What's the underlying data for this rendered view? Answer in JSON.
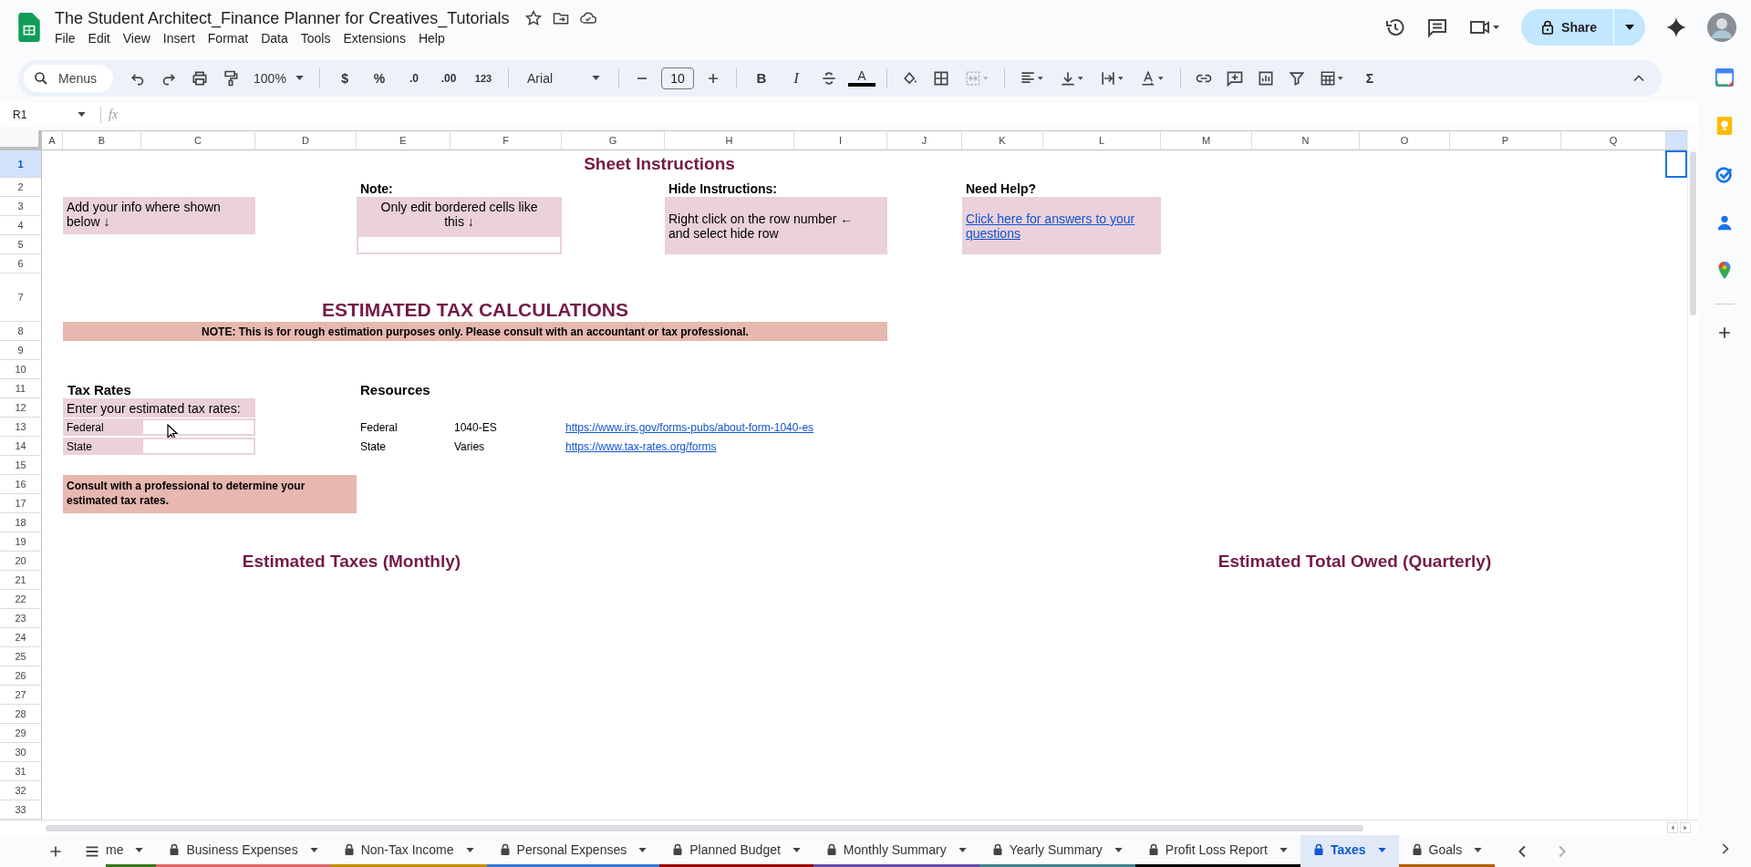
{
  "document": {
    "title": "The Student Architect_Finance Planner for Creatives_Tutorials"
  },
  "menu": [
    "File",
    "Edit",
    "View",
    "Insert",
    "Format",
    "Data",
    "Tools",
    "Extensions",
    "Help"
  ],
  "share": {
    "label": "Share"
  },
  "toolbar": {
    "search_label": "Menus",
    "zoom": "100%",
    "currency": "$",
    "percent": "%",
    "decrease_decimals": ".0",
    "increase_decimals": ".00",
    "more_formats": "123",
    "font": "Arial",
    "font_size": "10",
    "bold": "B",
    "italic": "I",
    "text_color": "A",
    "sum": "Σ",
    "merge_disabled": true
  },
  "name_box": "R1",
  "formula_label": "fx",
  "columns": [
    {
      "label": "A",
      "selected": false
    },
    {
      "label": "B",
      "selected": false
    },
    {
      "label": "C",
      "selected": false
    },
    {
      "label": "D",
      "selected": false
    },
    {
      "label": "E",
      "selected": false
    },
    {
      "label": "F",
      "selected": false
    },
    {
      "label": "G",
      "selected": false
    },
    {
      "label": "H",
      "selected": false
    },
    {
      "label": "I",
      "selected": false
    },
    {
      "label": "J",
      "selected": false
    },
    {
      "label": "K",
      "selected": false
    },
    {
      "label": "L",
      "selected": false
    },
    {
      "label": "M",
      "selected": false
    },
    {
      "label": "N",
      "selected": false
    },
    {
      "label": "O",
      "selected": false
    },
    {
      "label": "P",
      "selected": false
    },
    {
      "label": "Q",
      "selected": false
    },
    {
      "selected": true
    }
  ],
  "rows": [
    {
      "label": "1",
      "selected": true
    },
    {
      "label": "2",
      "selected": false
    },
    {
      "label": "3",
      "selected": false
    },
    {
      "label": "4",
      "selected": false
    },
    {
      "label": "5",
      "selected": false
    },
    {
      "label": "6",
      "selected": false
    },
    {
      "label": "7",
      "selected": false
    },
    {
      "label": "8",
      "selected": false
    },
    {
      "label": "9",
      "selected": false
    },
    {
      "label": "10",
      "selected": false
    },
    {
      "label": "11",
      "selected": false
    },
    {
      "label": "12",
      "selected": false
    },
    {
      "label": "13",
      "selected": false
    },
    {
      "label": "14",
      "selected": false
    },
    {
      "label": "15",
      "selected": false
    },
    {
      "label": "16",
      "selected": false
    },
    {
      "label": "17",
      "selected": false
    },
    {
      "label": "18",
      "selected": false
    },
    {
      "label": "19",
      "selected": false
    },
    {
      "label": "20",
      "selected": false
    },
    {
      "label": "21",
      "selected": false
    },
    {
      "label": "22",
      "selected": false
    },
    {
      "label": "23",
      "selected": false
    },
    {
      "label": "24",
      "selected": false
    },
    {
      "label": "25",
      "selected": false
    },
    {
      "label": "26",
      "selected": false
    },
    {
      "label": "27",
      "selected": false
    },
    {
      "label": "28",
      "selected": false
    },
    {
      "label": "29",
      "selected": false
    },
    {
      "label": "30",
      "selected": false
    },
    {
      "label": "31",
      "selected": false
    },
    {
      "label": "32",
      "selected": false
    },
    {
      "label": "33",
      "selected": false
    }
  ],
  "instructions": {
    "title": "Sheet Instructions",
    "info": "Add your info where shown below ↓",
    "note_heading": "Note:",
    "note": "Only edit bordered cells like this ↓",
    "hide_heading": "Hide Instructions:",
    "hide": "Right click on the row number ←  and select hide row",
    "help_heading": "Need Help?",
    "help_link": "Click here for answers to your questions"
  },
  "tax_calc": {
    "title": "ESTIMATED TAX CALCULATIONS",
    "note": "NOTE: This is for rough estimation purposes only. Please consult with an accountant or tax professional."
  },
  "tax_rates": {
    "heading": "Tax Rates",
    "prompt": "Enter your estimated tax rates:",
    "rows": [
      {
        "label": "Federal"
      },
      {
        "label": "State"
      }
    ]
  },
  "resources": {
    "heading": "Resources",
    "items": [
      {
        "region": "Federal",
        "form": "1040-ES",
        "link": "https://www.irs.gov/forms-pubs/about-form-1040-es"
      },
      {
        "region": "State",
        "form": "Varies",
        "link": "https://www.tax-rates.org/forms"
      }
    ]
  },
  "consult_note": "Consult with a professional to determine your estimated tax rates.",
  "chart_titles": [
    "Estimated Taxes (Monthly)",
    "Estimated Total Owed (Quarterly)"
  ],
  "sheet_tabs": [
    {
      "label": "me",
      "locked": false,
      "selected": false,
      "color": "#38761d"
    },
    {
      "label": "Business Expenses",
      "locked": true,
      "selected": false,
      "color": "#e06666"
    },
    {
      "label": "Non-Tax Income",
      "locked": true,
      "selected": false,
      "color": "#bf9000"
    },
    {
      "label": "Personal Expenses",
      "locked": true,
      "selected": false,
      "color": "#3c78d8"
    },
    {
      "label": "Planned Budget",
      "locked": true,
      "selected": false,
      "color": "#990000"
    },
    {
      "label": "Monthly Summary",
      "locked": true,
      "selected": false,
      "color": "#674ea7"
    },
    {
      "label": "Yearly Summary",
      "locked": true,
      "selected": false,
      "color": "#45818e"
    },
    {
      "label": "Profit Loss Report",
      "locked": true,
      "selected": false,
      "color": "#000000"
    },
    {
      "label": "Taxes",
      "locked": true,
      "selected": true
    },
    {
      "label": "Goals",
      "locked": true,
      "selected": false,
      "color": "#b45f06"
    }
  ]
}
